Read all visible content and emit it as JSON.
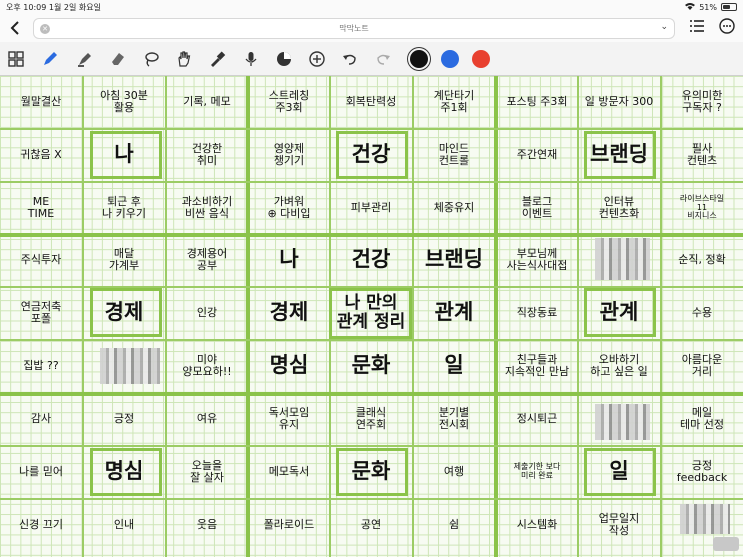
{
  "status_bar": {
    "time": "오후 10:09",
    "date": "1월 2일 화요일",
    "battery": "51%",
    "battery_level": 0.51
  },
  "document": {
    "title": "막막노트"
  },
  "toolbar": {
    "tools": [
      "grid-icon",
      "pen-icon",
      "highlighter-icon",
      "eraser-icon",
      "lasso-icon",
      "hand-icon",
      "dropper-icon",
      "mic-icon",
      "shapes-icon",
      "add-icon",
      "undo-icon",
      "redo-icon"
    ],
    "colors": [
      "#111111",
      "#2b6be0",
      "#e8402f"
    ],
    "selected_color": "#111111"
  },
  "grid": [
    [
      "월말결산",
      "아침 30분\n활용",
      "기록, 메모",
      "스트레칭\n주3회",
      "회복탄력성",
      "계단타기\n주1회",
      "포스팅 주3회",
      "일 방문자 300",
      "유의미한\n구독자 ?"
    ],
    [
      "귀찮음 X",
      "나",
      "건강한\n취미",
      "영양제\n챙기기",
      "건강",
      "마인드\n컨트롤",
      "주간연재",
      "브랜딩",
      "필사\n컨텐츠"
    ],
    [
      "ME\nTIME",
      "퇴근 후\n나 키우기",
      "과소비하기\n비싼 음식",
      "가벼워\n⊕ 다비입",
      "피부관리",
      "체중유지",
      "블로그\n이벤트",
      "인터뷰\n컨텐츠화",
      "라이브스타일\n11\n비지니스"
    ],
    [
      "주식투자",
      "매달\n가계부",
      "경제용어\n공부",
      "나",
      "건강",
      "브랜딩",
      "부모님께\n사는식사대접",
      "",
      "순직, 정확"
    ],
    [
      "연금저축\n포폴",
      "경제",
      "인강",
      "경제",
      "나 만의\n관계 정리",
      "관계",
      "직장동료",
      "관계",
      "수용"
    ],
    [
      "집밥 ??",
      "",
      "미야\n양모요하!!",
      "명심",
      "문화",
      "일",
      "친구들과\n지속적인 만남",
      "오바하기\n하고 싶은 일",
      "아름다운\n거리"
    ],
    [
      "감사",
      "긍정",
      "여유",
      "독서모임\n유지",
      "클래식\n연주회",
      "분기별\n전시회",
      "정시퇴근",
      "",
      "메일\n테마 선정"
    ],
    [
      "나를 믿어",
      "명심",
      "오늘을\n잘 살자",
      "메모독서",
      "문화",
      "여행",
      "제출기한 보다\n미리 완료",
      "일",
      "긍정\nfeedback"
    ],
    [
      "신경 끄기",
      "인내",
      "웃음",
      "폴라로이드",
      "공연",
      "쉼",
      "시스템화",
      "업무일지\n작성",
      ""
    ]
  ]
}
